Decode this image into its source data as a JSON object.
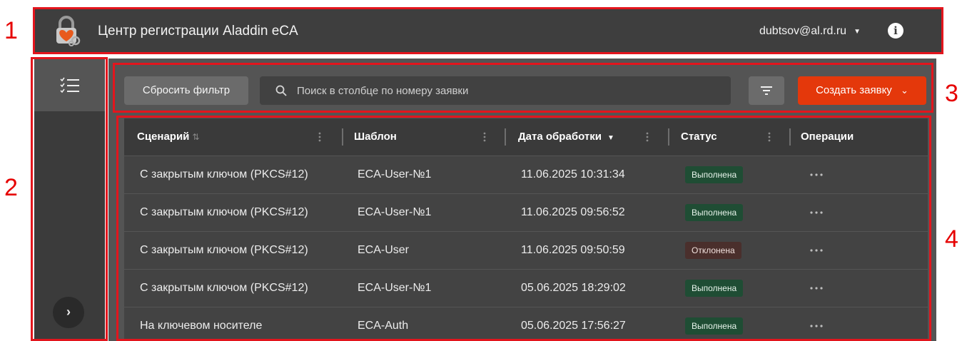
{
  "annotations": [
    "1",
    "2",
    "3",
    "4"
  ],
  "header": {
    "title": "Центр регистрации Aladdin eCA",
    "user": "dubtsov@al.rd.ru"
  },
  "toolbar": {
    "reset_label": "Сбросить фильтр",
    "search_placeholder": "Поиск в столбце по номеру заявки",
    "create_label": "Создать заявку"
  },
  "table": {
    "columns": [
      "Сценарий",
      "Шаблон",
      "Дата обработки",
      "Статус",
      "Операции"
    ],
    "rows": [
      {
        "scenario": "С закрытым ключом (PKCS#12)",
        "template": "ECA-User-№1",
        "date": "11.06.2025 10:31:34",
        "status": "Выполнена",
        "status_type": "ok"
      },
      {
        "scenario": "С закрытым ключом (PKCS#12)",
        "template": "ECA-User-№1",
        "date": "11.06.2025 09:56:52",
        "status": "Выполнена",
        "status_type": "ok"
      },
      {
        "scenario": "С закрытым ключом (PKCS#12)",
        "template": "ECA-User",
        "date": "11.06.2025 09:50:59",
        "status": "Отклонена",
        "status_type": "rejected"
      },
      {
        "scenario": "С закрытым ключом (PKCS#12)",
        "template": "ECA-User-№1",
        "date": "05.06.2025 18:29:02",
        "status": "Выполнена",
        "status_type": "ok"
      },
      {
        "scenario": "На ключевом носителе",
        "template": "ECA-Auth",
        "date": "05.06.2025 17:56:27",
        "status": "Выполнена",
        "status_type": "ok"
      }
    ]
  },
  "colors": {
    "accent": "#e4380b",
    "annotation": "#e3151d",
    "status_ok": "#1f4d34",
    "status_rejected": "#4a2f2c"
  },
  "icons": [
    "logo-icon",
    "caret-down-icon",
    "info-icon",
    "list-icon",
    "chevron-right-icon",
    "search-icon",
    "filter-icon",
    "chevron-down-icon",
    "sort-icon",
    "more-vertical-icon",
    "more-horizontal-icon"
  ]
}
